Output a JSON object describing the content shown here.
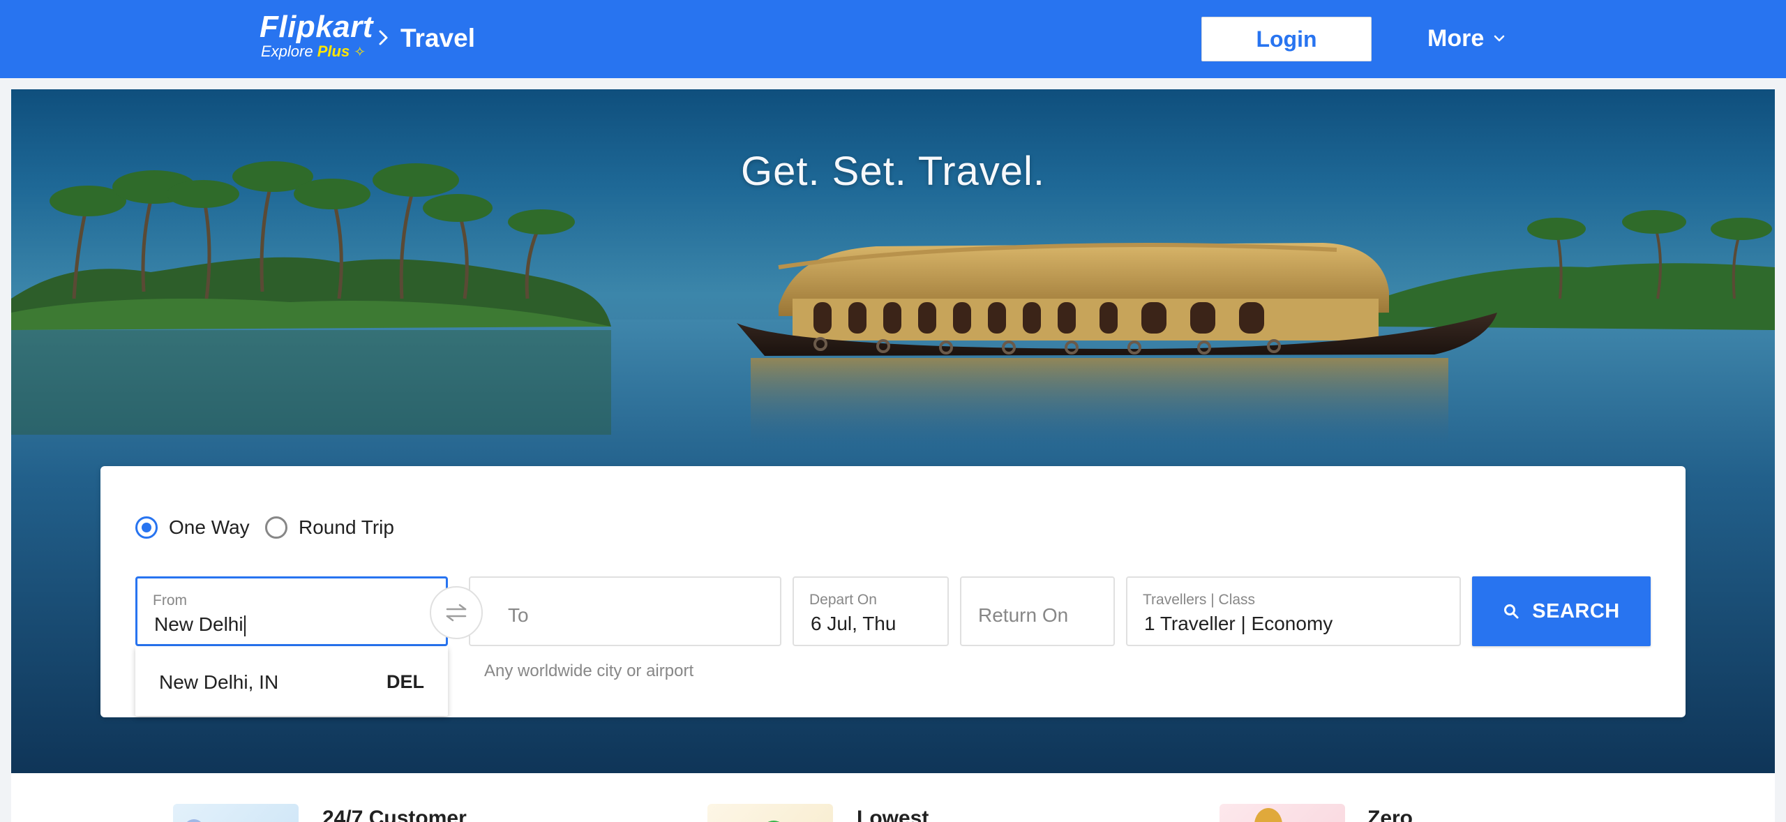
{
  "header": {
    "brand": "Flipkart",
    "brand_sub": "Explore",
    "brand_plus": "Plus",
    "section": "Travel",
    "login_label": "Login",
    "more_label": "More",
    "bg_color": "#2874f0"
  },
  "hero": {
    "tagline": "Get. Set. Travel."
  },
  "search": {
    "trip_types": [
      {
        "label": "One Way",
        "selected": true
      },
      {
        "label": "Round Trip",
        "selected": false
      }
    ],
    "from": {
      "label": "From",
      "value": "New Delhi"
    },
    "to": {
      "placeholder": "To",
      "helper": "Any worldwide city or airport"
    },
    "depart": {
      "label": "Depart On",
      "value": "6 Jul, Thu"
    },
    "return": {
      "placeholder": "Return On"
    },
    "travellers": {
      "label": "Travellers | Class",
      "value": "1 Traveller | Economy"
    },
    "search_label": "SEARCH",
    "suggestions": [
      {
        "city": "New Delhi, IN",
        "code": "DEL"
      }
    ]
  },
  "features": [
    {
      "title": "24/7 Customer"
    },
    {
      "title": "Lowest"
    },
    {
      "title": "Zero"
    }
  ],
  "icons": [
    "chevron-right-icon",
    "chevron-down-icon",
    "swap-icon",
    "search-icon"
  ]
}
